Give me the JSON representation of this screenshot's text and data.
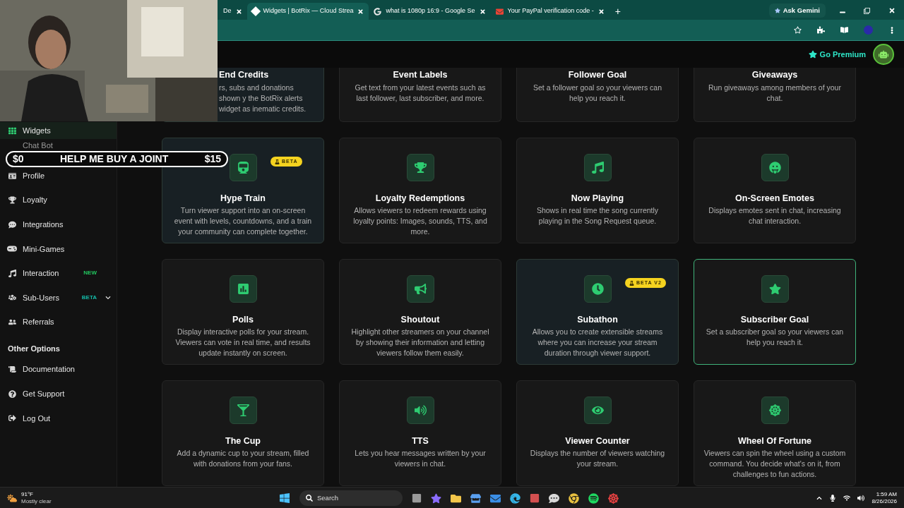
{
  "browser": {
    "tabs": [
      {
        "title": "De",
        "selected": false
      },
      {
        "title": "Widgets | BotRix — Cloud Strea",
        "selected": true
      },
      {
        "title": "what is 1080p 16:9 - Google Se",
        "selected": false
      },
      {
        "title": "Your PayPal verification code -",
        "selected": false
      }
    ],
    "new_tab": "+",
    "ask_button": "Ask Gemini"
  },
  "header": {
    "premium": "Go Premium"
  },
  "sidebar": {
    "items": [
      {
        "label": "Widgets",
        "selected": true
      },
      {
        "label": "Chat Bot",
        "selected": false
      },
      {
        "label": "Profile",
        "selected": false
      },
      {
        "label": "Loyalty",
        "selected": false
      },
      {
        "label": "Integrations",
        "selected": false
      },
      {
        "label": "Mini-Games",
        "selected": false
      },
      {
        "label": "Interaction",
        "selected": false,
        "badge": "NEW",
        "color": "#22c55e"
      },
      {
        "label": "Sub-Users",
        "selected": false,
        "badge": "BETA",
        "color": "#14b8a6",
        "expandable": true
      },
      {
        "label": "Referrals",
        "selected": false
      }
    ],
    "section": "Other Options",
    "other_items": [
      {
        "label": "Documentation"
      },
      {
        "label": "Get Support"
      },
      {
        "label": "Log Out"
      }
    ]
  },
  "cards": [
    {
      "title": "End Credits",
      "description": "rs, subs and donations shown y the BotRix alerts widget as inematic credits.",
      "highlighted": true,
      "selected": false,
      "cut_top": true,
      "cut_left": true
    },
    {
      "title": "Event Labels",
      "description": "Get text from your latest events such as last follower, last subscriber, and more.",
      "highlighted": false,
      "selected": false,
      "cut_top": true
    },
    {
      "title": "Follower Goal",
      "description": "Set a follower goal so your viewers can help you reach it.",
      "highlighted": false,
      "selected": false,
      "cut_top": true
    },
    {
      "title": "Giveaways",
      "description": "Run giveaways among members of your chat.",
      "highlighted": false,
      "selected": false,
      "cut_top": true
    },
    {
      "title": "Hype Train",
      "description": "Turn viewer support into an on-screen event with levels, countdowns, and a train your community can complete together.",
      "highlighted": true,
      "selected": false,
      "badge": "BETA"
    },
    {
      "title": "Loyalty Redemptions",
      "description": "Allows viewers to redeem rewards using loyalty points: Images, sounds, TTS, and more.",
      "highlighted": false,
      "selected": false
    },
    {
      "title": "Now Playing",
      "description": "Shows in real time the song currently playing in the Song Request queue.",
      "highlighted": false,
      "selected": false
    },
    {
      "title": "On-Screen Emotes",
      "description": "Displays emotes sent in chat, increasing chat interaction.",
      "highlighted": false,
      "selected": false
    },
    {
      "title": "Polls",
      "description": "Display interactive polls for your stream. Viewers can vote in real time, and results update instantly on screen.",
      "highlighted": false,
      "selected": false
    },
    {
      "title": "Shoutout",
      "description": "Highlight other streamers on your channel by showing their information and letting viewers follow them easily.",
      "highlighted": false,
      "selected": false
    },
    {
      "title": "Subathon",
      "description": "Allows you to create extensible streams where you can increase your stream duration through viewer support.",
      "highlighted": true,
      "selected": false,
      "badge": "BETA V2"
    },
    {
      "title": "Subscriber Goal",
      "description": "Set a subscriber goal so your viewers can help you reach it.",
      "highlighted": false,
      "selected": true
    },
    {
      "title": "The Cup",
      "description": "Add a dynamic cup to your stream, filled with donations from your fans.",
      "highlighted": false,
      "selected": false
    },
    {
      "title": "TTS",
      "description": "Lets you hear messages written by your viewers in chat.",
      "highlighted": false,
      "selected": false
    },
    {
      "title": "Viewer Counter",
      "description": "Displays the number of viewers watching your stream.",
      "highlighted": false,
      "selected": false
    },
    {
      "title": "Wheel Of Fortune",
      "description": "Viewers can spin the wheel using a custom command. You decide what's on it, from challenges to fun actions.",
      "highlighted": false,
      "selected": false
    }
  ],
  "donation_bar": {
    "current": "$0",
    "goal_text": "HELP ME BUY A JOINT",
    "target": "$15",
    "level": 0
  },
  "taskbar": {
    "temperature": "91°F",
    "weather": "Mostly clear",
    "search": "Search",
    "time": "1:59 AM",
    "date": "8/26/2026"
  }
}
